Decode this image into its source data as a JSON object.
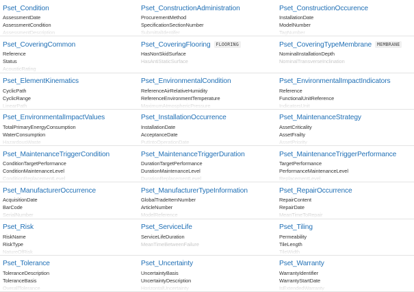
{
  "psets": [
    {
      "name": "Pset_Condition",
      "badge": "",
      "props": [
        "AssessmentDate",
        "AssessmentCondition",
        "AssessmentDescription"
      ]
    },
    {
      "name": "Pset_ConstructionAdministration",
      "badge": "",
      "props": [
        "ProcurementMethod",
        "SpecificationSectionNumber",
        "SubmittalIdentifer"
      ]
    },
    {
      "name": "Pset_ConstructionOccurence",
      "badge": "",
      "props": [
        "InstallationDate",
        "ModelNumber",
        "TagNumber"
      ]
    },
    {
      "name": "Pset_CoveringCommon",
      "badge": "",
      "props": [
        "Reference",
        "Status",
        "AcousticRating"
      ]
    },
    {
      "name": "Pset_CoveringFlooring",
      "badge": "FLOORING",
      "props": [
        "HasNonSkidSurface",
        "HasAntiStaticSurface"
      ]
    },
    {
      "name": "Pset_CoveringTypeMembrane",
      "badge": "MEMBRANE",
      "props": [
        "NominalInstallationDepth",
        "NominalTransverseInclination"
      ]
    },
    {
      "name": "Pset_ElementKinematics",
      "badge": "",
      "props": [
        "CyclicPath",
        "CyclicRange",
        "LinearPath"
      ]
    },
    {
      "name": "Pset_EnvironmentalCondition",
      "badge": "",
      "props": [
        "ReferenceAirRelativeHumidity",
        "ReferenceEnvironmentTemperature",
        "MaximumAtmosphericPressure"
      ]
    },
    {
      "name": "Pset_EnvironmentalImpactIndicators",
      "badge": "",
      "props": [
        "Reference",
        "FunctionalUnitReference",
        "IndicatorsUnit"
      ]
    },
    {
      "name": "Pset_EnvironmentalImpactValues",
      "badge": "",
      "props": [
        "TotalPrimaryEnergyConsumption",
        "WaterConsumption",
        "HazardousWaste"
      ]
    },
    {
      "name": "Pset_InstallationOccurrence",
      "badge": "",
      "props": [
        "InstallationDate",
        "AcceptanceDate",
        "PutIntoOperationDate"
      ]
    },
    {
      "name": "Pset_MaintenanceStrategy",
      "badge": "",
      "props": [
        "AssetCriticality",
        "AssetFrailty",
        "AssetPriority"
      ]
    },
    {
      "name": "Pset_MaintenanceTriggerCondition",
      "badge": "",
      "props": [
        "ConditionTargetPerformance",
        "ConditionMaintenanceLevel",
        "ConditionReplacementLevel"
      ]
    },
    {
      "name": "Pset_MaintenanceTriggerDuration",
      "badge": "",
      "props": [
        "DurationTargetPerformance",
        "DurationMaintenanceLevel",
        "DurationReplacementLevel"
      ]
    },
    {
      "name": "Pset_MaintenanceTriggerPerformance",
      "badge": "",
      "props": [
        "TargetPerformance",
        "PerformanceMaintenanceLevel",
        "ReplacementLevel"
      ]
    },
    {
      "name": "Pset_ManufacturerOccurrence",
      "badge": "",
      "props": [
        "AcquisitionDate",
        "BarCode",
        "SerialNumber"
      ]
    },
    {
      "name": "Pset_ManufacturerTypeInformation",
      "badge": "",
      "props": [
        "GlobalTradeItemNumber",
        "ArticleNumber",
        "ModelReference"
      ]
    },
    {
      "name": "Pset_RepairOccurrence",
      "badge": "",
      "props": [
        "RepairContent",
        "RepairDate",
        "MeanTimeToRepair"
      ]
    },
    {
      "name": "Pset_Risk",
      "badge": "",
      "props": [
        "RiskName",
        "RiskType",
        "NatureOfRisk"
      ]
    },
    {
      "name": "Pset_ServiceLife",
      "badge": "",
      "props": [
        "ServiceLifeDuration",
        "MeanTimeBetweenFailure"
      ]
    },
    {
      "name": "Pset_Tiling",
      "badge": "",
      "props": [
        "Permeability",
        "TileLength",
        "TileWidth"
      ]
    },
    {
      "name": "Pset_Tolerance",
      "badge": "",
      "props": [
        "ToleranceDescription",
        "ToleranceBasis",
        "OverallTolerance"
      ]
    },
    {
      "name": "Pset_Uncertainty",
      "badge": "",
      "props": [
        "UncertaintyBasis",
        "UncertaintyDescription",
        "HorizontalUncertainty"
      ]
    },
    {
      "name": "Pset_Warranty",
      "badge": "",
      "props": [
        "WarrantyIdentifier",
        "WarrantyStartDate",
        "IsExtendedWarranty"
      ]
    }
  ]
}
